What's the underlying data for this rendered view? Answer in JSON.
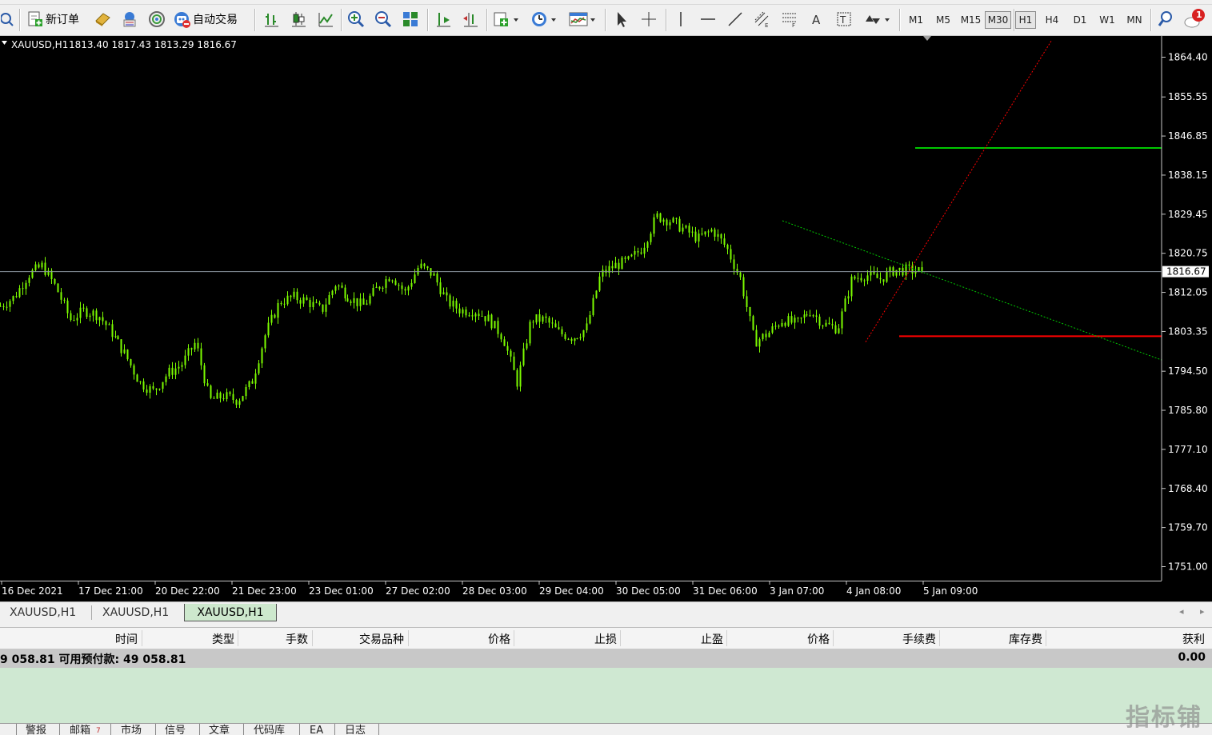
{
  "toolbar": {
    "new_order_label": "新订单",
    "auto_trading_label": "自动交易",
    "timeframes": [
      "M1",
      "M5",
      "M15",
      "M30",
      "H1",
      "H4",
      "D1",
      "W1",
      "MN"
    ],
    "active_timeframe": "M30",
    "notification_count": "1"
  },
  "chart": {
    "header": "XAUUSD,H1  1813.40 1817.43 1813.29 1816.67",
    "symbol": "XAUUSD,H1",
    "ohlc": "1813.40 1817.43 1813.29 1816.67",
    "current_price_label": "1816.67",
    "colors": {
      "background": "#000000",
      "candles": "#7cfc00",
      "bid_line": "#8c96a0",
      "resistance": "#00c800",
      "support": "#ff0000",
      "trend_down": "#00c800",
      "trend_up": "#ff0000"
    }
  },
  "chart_data": {
    "type": "candlestick",
    "symbol": "XAUUSD",
    "timeframe": "H1",
    "ylim": [
      1745.0,
      1869.0
    ],
    "y_ticks": [
      "1864.40",
      "1855.55",
      "1846.85",
      "1838.15",
      "1829.45",
      "1820.75",
      "1812.05",
      "1803.35",
      "1794.50",
      "1785.80",
      "1777.10",
      "1768.40",
      "1759.70",
      "1751.00"
    ],
    "x_ticks": [
      "16 Dec 2021",
      "17 Dec 21:00",
      "20 Dec 22:00",
      "21 Dec 23:00",
      "23 Dec 01:00",
      "27 Dec 02:00",
      "28 Dec 03:00",
      "29 Dec 04:00",
      "30 Dec 05:00",
      "31 Dec 06:00",
      "3 Jan 07:00",
      "4 Jan 08:00",
      "5 Jan 09:00"
    ],
    "close_path": [
      1809,
      1811,
      1816,
      1818,
      1813,
      1806,
      1808,
      1807,
      1803,
      1798,
      1792,
      1790,
      1794,
      1796,
      1801,
      1788,
      1789,
      1788,
      1792,
      1803,
      1810,
      1811,
      1810,
      1808,
      1814,
      1811,
      1809,
      1813,
      1816,
      1812,
      1818,
      1816,
      1810,
      1808,
      1808,
      1806,
      1802,
      1792,
      1806,
      1806,
      1803,
      1802,
      1804,
      1816,
      1818,
      1819,
      1822,
      1829,
      1828,
      1826,
      1824,
      1826,
      1822,
      1815,
      1801,
      1803,
      1806,
      1805,
      1808,
      1805,
      1804,
      1815,
      1816,
      1815,
      1817,
      1817,
      1816.67
    ],
    "horizontal_lines": [
      {
        "price": 1844.2,
        "color": "green"
      },
      {
        "price": 1816.67,
        "color": "gray",
        "label": "1816.67"
      },
      {
        "price": 1802.3,
        "color": "red"
      }
    ],
    "trend_lines": [
      {
        "style": "dotted",
        "color": "green",
        "from": [
          "3 Jan",
          1828.0
        ],
        "to": [
          "5 Jan",
          1797.0
        ]
      },
      {
        "style": "dotted",
        "color": "red",
        "from": [
          "4 Jan",
          1801.0
        ],
        "to": [
          "5 Jan",
          1868.0
        ]
      }
    ]
  },
  "chart_tabs": [
    "XAUUSD,H1",
    "XAUUSD,H1",
    "XAUUSD,H1"
  ],
  "active_chart_tab": 2,
  "terminal": {
    "columns": [
      "时间",
      "类型",
      "手数",
      "交易品种",
      "价格",
      "止损",
      "止盈",
      "价格",
      "手续费",
      "库存费",
      "获利"
    ],
    "balance_text": "9 058.81  可用预付款: 49 058.81",
    "profit_total": "0.00"
  },
  "bottom_tabs": [
    "警报",
    "邮箱",
    "市场",
    "信号",
    "文章",
    "代码库",
    "EA",
    "日志"
  ],
  "mail_count": "7",
  "watermark": "指标铺"
}
